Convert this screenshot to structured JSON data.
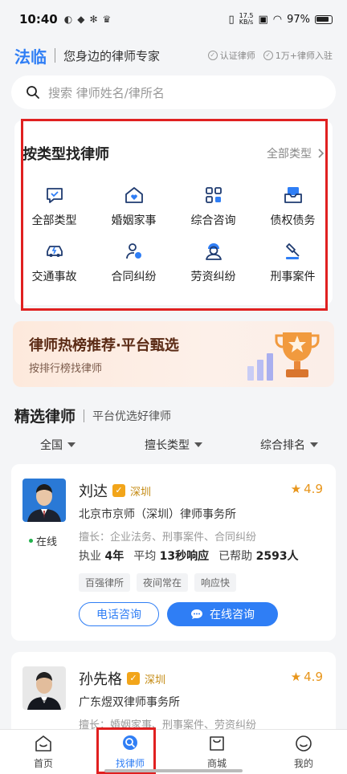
{
  "status_bar": {
    "time": "10:40",
    "net_speed_value": "17.5",
    "net_speed_unit": "KB/s",
    "battery": "97%"
  },
  "header": {
    "brand": "法临",
    "slogan": "您身边的律师专家",
    "badge_verified": "认证律师",
    "badge_count": "1万+律师入驻"
  },
  "search": {
    "placeholder": "搜索 律师姓名/律所名"
  },
  "lawyer_types": {
    "title": "按类型找律师",
    "all_link": "全部类型",
    "items": [
      {
        "label": "全部类型",
        "icon": "chat-check-icon"
      },
      {
        "label": "婚姻家事",
        "icon": "home-heart-icon"
      },
      {
        "label": "综合咨询",
        "icon": "grid-icon"
      },
      {
        "label": "债权债务",
        "icon": "money-box-icon"
      },
      {
        "label": "交通事故",
        "icon": "car-icon"
      },
      {
        "label": "合同纠纷",
        "icon": "contract-hand-icon"
      },
      {
        "label": "劳资纠纷",
        "icon": "worker-icon"
      },
      {
        "label": "刑事案件",
        "icon": "gavel-icon"
      }
    ]
  },
  "banner": {
    "title": "律师热榜推荐·平台甄选",
    "subtitle": "按排行榜找律师"
  },
  "featured": {
    "title": "精选律师",
    "subtitle": "平台优选好律师"
  },
  "filters": [
    "全国",
    "擅长类型",
    "综合排名"
  ],
  "lawyers": [
    {
      "name": "刘达",
      "city": "深圳",
      "rating": "4.9",
      "firm": "北京市京师（深圳）律师事务所",
      "specialty": "擅长：企业法务、刑事案件、合同纠纷",
      "status": "在线",
      "years_label": "执业",
      "years": "4年",
      "response_label": "平均",
      "response": "13秒响应",
      "helped_label": "已帮助",
      "helped": "2593人",
      "tags": [
        "百强律所",
        "夜间常在",
        "响应快"
      ],
      "btn_phone": "电话咨询",
      "btn_online": "在线咨询"
    },
    {
      "name": "孙先格",
      "city": "深圳",
      "rating": "4.9",
      "firm": "广东煜双律师事务所",
      "specialty": "擅长：婚姻家事、刑事案件、劳资纠纷"
    }
  ],
  "tabbar": [
    {
      "label": "首页",
      "icon": "home-icon"
    },
    {
      "label": "找律师",
      "icon": "search-bubble-icon"
    },
    {
      "label": "商城",
      "icon": "shop-bag-icon"
    },
    {
      "label": "我的",
      "icon": "smile-icon"
    }
  ],
  "colors": {
    "accent": "#2f7ef5",
    "highlight_box": "#e02020",
    "rating": "#e8951a"
  }
}
